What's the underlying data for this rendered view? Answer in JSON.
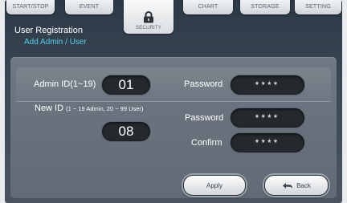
{
  "tabs": [
    {
      "label": "START/STOP"
    },
    {
      "label": "EVENT"
    },
    {
      "label": "SECURITY"
    },
    {
      "label": "CHART"
    },
    {
      "label": "STORAGE"
    },
    {
      "label": "SETTING"
    }
  ],
  "header": {
    "title": "User Registration",
    "subtitle": "Add Admin / User"
  },
  "admin": {
    "id_label": "Admin ID(1~19)",
    "id_value": "01",
    "password_label": "Password",
    "password_value": "****"
  },
  "new_user": {
    "id_label": "New ID",
    "id_hint": "(1 ~ 19  Admin, 20 ~ 99 User)",
    "id_value": "08",
    "password_label": "Password",
    "password_value": "****",
    "confirm_label": "Confirm",
    "confirm_value": "****"
  },
  "buttons": {
    "apply": "Apply",
    "back": "Back"
  },
  "colors": {
    "accent": "#4fd0e6",
    "panel": "#6f7882",
    "field": "#24292e"
  }
}
